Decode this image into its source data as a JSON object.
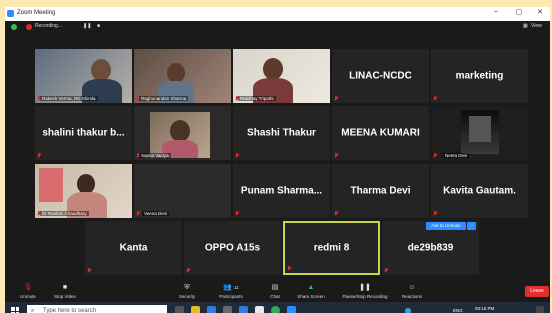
{
  "window": {
    "title": "Zoom Meeting",
    "min": "–",
    "max": "▢",
    "close": "✕"
  },
  "meeting_bar": {
    "recording": "Recording...",
    "view": "View"
  },
  "tiles": [
    {
      "label": "Rakesh Verma, RD Shimla"
    },
    {
      "label": "Raghunandan Sharma"
    },
    {
      "label": "Rakshay Tripathi"
    },
    {
      "name": "LINAC-NCDC"
    },
    {
      "name": "marketing"
    },
    {
      "name": "shalini thakur b..."
    },
    {
      "label": "Sapna Vaidya"
    },
    {
      "name": "Shashi Thakur"
    },
    {
      "name": "MEENA KUMARI"
    },
    {
      "label": "Neeta Devi"
    },
    {
      "label": "Dr Rashmi Chaudhary"
    },
    {
      "label": "Veena Devi"
    },
    {
      "name": "Punam  Sharma..."
    },
    {
      "name": "Tharma Devi"
    },
    {
      "name": "Kavita Gautam."
    },
    {
      "name": "Kanta"
    },
    {
      "name": "OPPO A15s"
    },
    {
      "name": "redmi 8"
    },
    {
      "name": "de29b839"
    }
  ],
  "ask_to_unmute": "Ask to Unmute",
  "toolbar": {
    "unmute": "Unmute",
    "stop_video": "Stop Video",
    "security": "Security",
    "participants": "Participants",
    "participants_count": "11",
    "chat": "Chat",
    "share_screen": "Share Screen",
    "pause_recording": "Pause/Stop Recording",
    "reactions": "Reactions",
    "leave": "Leave"
  },
  "taskbar": {
    "search_placeholder": "Type here to search",
    "lang": "ENG",
    "time": "03:16 PM"
  },
  "colors": {
    "accent": "#2d8cff",
    "leave": "#e02f2f",
    "active_speaker": "#c7d64c",
    "muted": "#e02828"
  }
}
